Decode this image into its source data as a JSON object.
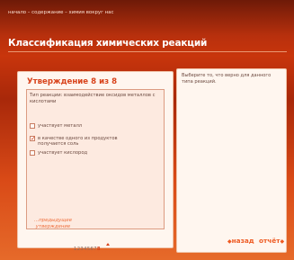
{
  "breadcrumb": "начало – содержание – химия вокруг нас",
  "page_title": "Классификация химических реакций",
  "statement": {
    "heading": "Утверждение 8 из 8",
    "question": "Тип реакции: взаимодействие оксидов металлов с кислотами",
    "options": [
      {
        "label": "участвует металл",
        "checked": false
      },
      {
        "label": "в качестве одного из продуктов получается соль",
        "checked": true
      },
      {
        "label": "участвует кислород",
        "checked": false
      }
    ],
    "checkmark": "✓",
    "prev_line1": "...предыдущее",
    "prev_line2": "утверждение",
    "pages": [
      "1",
      "2",
      "3",
      "4",
      "5",
      "6",
      "7",
      "8"
    ],
    "current_page": "8"
  },
  "instruction": "Выберите то, что верно для данного типа реакций.",
  "nav": {
    "back_arrow": "◆",
    "back_label": "назад",
    "report_label": "отчёт",
    "report_arrow": "◆"
  },
  "colors": {
    "accent": "#d8431b",
    "bg_top": "#6e1a08",
    "bg_bottom": "#e66a2a",
    "panel": "#fff6ef"
  }
}
